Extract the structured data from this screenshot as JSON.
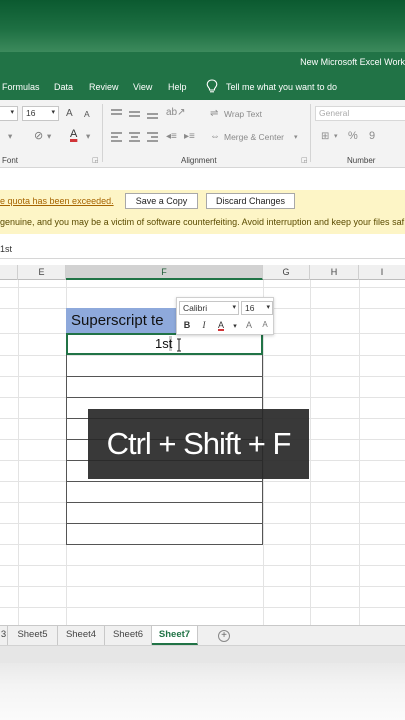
{
  "window": {
    "title": "New Microsoft Excel Work"
  },
  "menu": {
    "items": [
      "Formulas",
      "Data",
      "Review",
      "View",
      "Help"
    ],
    "tell_me": "Tell me what you want to do"
  },
  "ribbon": {
    "font_size": "16",
    "wrap_text": "Wrap Text",
    "merge_center": "Merge & Center",
    "number_format": "General",
    "percent_symbol": "%",
    "comma_symbol": "9",
    "font_group": "Font",
    "alignment_group": "Alignment",
    "number_group": "Number",
    "grow_font": "A",
    "shrink_font": "A",
    "font_color_glyph": "A"
  },
  "warnings": {
    "quota": "e quota has been exceeded.",
    "save_copy": "Save a Copy",
    "discard": "Discard Changes",
    "genuine": "genuine, and you may be a victim of software counterfeiting. Avoid interruption and keep your files saf"
  },
  "formula_bar": {
    "content": "1st"
  },
  "columns": [
    "E",
    "F",
    "G",
    "H",
    "I"
  ],
  "cells": {
    "header": "Superscript te",
    "active_before": "1s",
    "active_selected": "t"
  },
  "mini_toolbar": {
    "font": "Calibri",
    "size": "16",
    "bold": "B",
    "italic": "I",
    "font_color": "A",
    "grow": "A",
    "shrink": "A"
  },
  "shortcut": "Ctrl + Shift + F",
  "sheets": [
    "3",
    "Sheet5",
    "Sheet4",
    "Sheet6",
    "Sheet7"
  ],
  "active_sheet": "Sheet7",
  "add_sheet": "+",
  "colors": {
    "excel_green": "#217346",
    "header_fill": "#8ea9db",
    "warning_bg": "#fdf5c6",
    "font_color_red": "#d13438"
  }
}
